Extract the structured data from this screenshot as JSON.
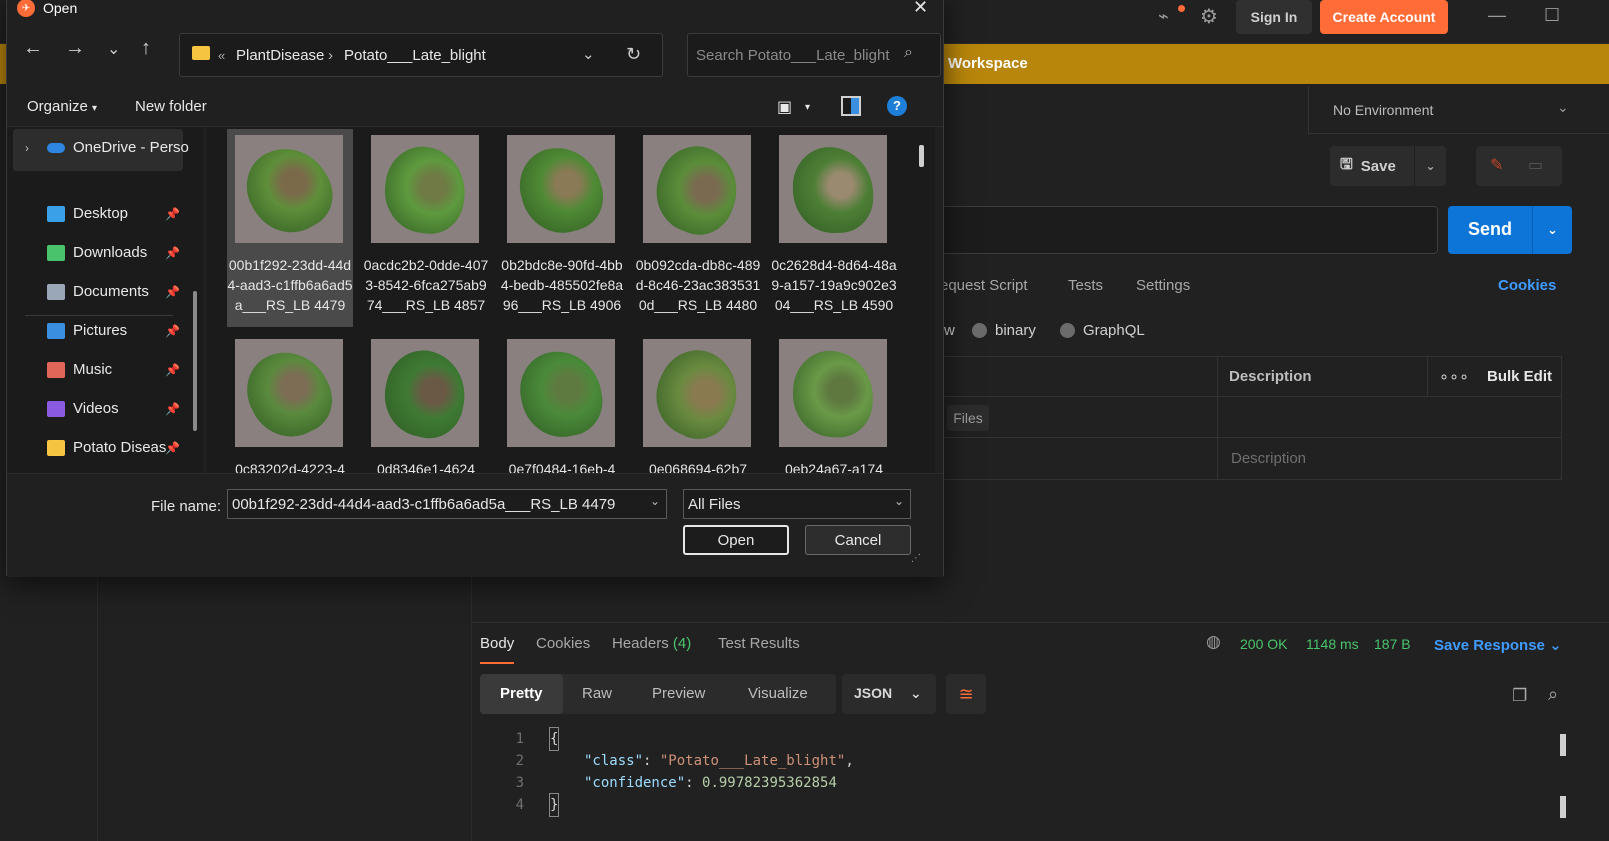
{
  "postman": {
    "sign_in": "Sign In",
    "create_account": "Create Account",
    "workspace_banner": "Workspace",
    "environment": "No Environment",
    "save": "Save",
    "send": "Send",
    "request_tabs": [
      "equest Script",
      "Tests",
      "Settings"
    ],
    "cookies": "Cookies",
    "body_types": [
      "w",
      "binary",
      "GraphQL"
    ],
    "table": {
      "description_header": "Description",
      "bulk_edit": "Bulk Edit",
      "files_tag": "Files",
      "description_placeholder": "Description"
    },
    "response_tabs": {
      "body": "Body",
      "cookies": "Cookies",
      "headers": "Headers",
      "headers_count": "(4)",
      "test_results": "Test Results"
    },
    "status": {
      "code": "200 OK",
      "time": "1148 ms",
      "size": "187 B"
    },
    "save_response": "Save Response",
    "formats": [
      "Pretty",
      "Raw",
      "Preview",
      "Visualize"
    ],
    "language": "JSON",
    "code_lines": {
      "line_numbers": [
        "1",
        "2",
        "3",
        "4"
      ],
      "open_brace": "{",
      "key1": "\"class\"",
      "val1": "\"Potato___Late_blight\"",
      "key2": "\"confidence\"",
      "val2": "0.99782395362854",
      "close_brace": "}"
    }
  },
  "dialog": {
    "title": "Open",
    "breadcrumb": {
      "root": "PlantDisease",
      "current": "Potato___Late_blight"
    },
    "search_placeholder": "Search Potato___Late_blight",
    "organize": "Organize",
    "new_folder": "New folder",
    "sidebar": {
      "onedrive": "OneDrive - Perso",
      "items": [
        {
          "label": "Desktop",
          "icon": "desktop-icon",
          "color": "#3aa0e8"
        },
        {
          "label": "Downloads",
          "icon": "download-icon",
          "color": "#49c46c"
        },
        {
          "label": "Documents",
          "icon": "document-icon",
          "color": "#9aa7b8"
        },
        {
          "label": "Pictures",
          "icon": "pictures-icon",
          "color": "#3a8fe0"
        },
        {
          "label": "Music",
          "icon": "music-icon",
          "color": "#e0665a"
        },
        {
          "label": "Videos",
          "icon": "videos-icon",
          "color": "#8a5ae0"
        },
        {
          "label": "Potato Diseas",
          "icon": "folder-icon",
          "color": "#f5c542"
        }
      ]
    },
    "files": [
      {
        "name": "00b1f292-23dd-44d4-aad3-c1ffb6a6ad5a___RS_LB 4479",
        "selected": true
      },
      {
        "name": "0acdc2b2-0dde-4073-8542-6fca275ab974___RS_LB 4857"
      },
      {
        "name": "0b2bdc8e-90fd-4bb4-bedb-485502fe8a96___RS_LB 4906"
      },
      {
        "name": "0b092cda-db8c-489d-8c46-23ac3835310d___RS_LB 4480"
      },
      {
        "name": "0c2628d4-8d64-48a9-a157-19a9c902e304___RS_LB 4590"
      },
      {
        "name": "0c83202d-4223-4"
      },
      {
        "name": "0d8346e1-4624"
      },
      {
        "name": "0e7f0484-16eb-4"
      },
      {
        "name": "0e068694-62b7"
      },
      {
        "name": "0eb24a67-a174"
      }
    ],
    "file_name_label": "File name:",
    "file_name_value": "00b1f292-23dd-44d4-aad3-c1ffb6a6ad5a___RS_LB 4479",
    "file_type": "All Files",
    "open_button": "Open",
    "cancel_button": "Cancel"
  }
}
